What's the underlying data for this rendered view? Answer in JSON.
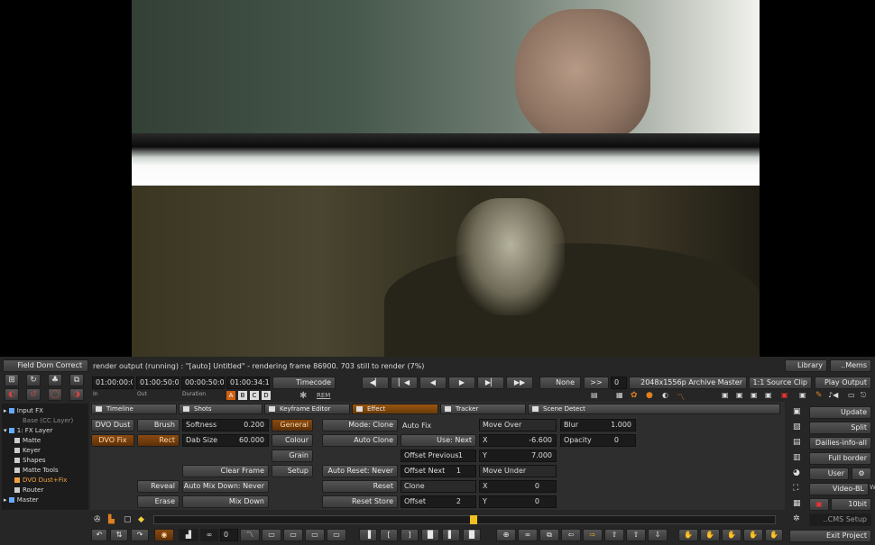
{
  "left_panel": {
    "field_dom_correct": "Field Dom Correct",
    "tree": [
      {
        "label": "Input FX",
        "level": 0,
        "accent": false
      },
      {
        "label": "Base (CC Layer)",
        "level": 1,
        "accent": false
      },
      {
        "label": "1: FX Layer",
        "level": 0,
        "accent": false
      },
      {
        "label": "Matte",
        "level": 2,
        "accent": false
      },
      {
        "label": "Keyer",
        "level": 2,
        "accent": false
      },
      {
        "label": "Shapes",
        "level": 2,
        "accent": false
      },
      {
        "label": "Matte Tools",
        "level": 2,
        "accent": false
      },
      {
        "label": "DVO Dust+Fix",
        "level": 2,
        "accent": true
      },
      {
        "label": "Router",
        "level": 2,
        "accent": false
      },
      {
        "label": "Master",
        "level": 0,
        "accent": false
      }
    ]
  },
  "status": {
    "render_text": "render output (running) : \"[auto] Untitled\" - rendering frame 86900. 703 still to render (7%)"
  },
  "timecodes": {
    "in": "01:00:00:00",
    "in_label": "In",
    "out": "01:00:50:00",
    "out_label": "Out",
    "duration": "00:00:50:00",
    "duration_label": "Duration",
    "current": "01:00:34:12",
    "mode_button": "Timecode",
    "abcd": [
      "A",
      "B",
      "C",
      "D"
    ],
    "rem_label": "REM"
  },
  "transport": {
    "none_label": "None",
    "chevron_label": ">>",
    "frame_value": "0",
    "resolution": "2048x1556p Archive Master",
    "source_clip": "1:1 Source Clip",
    "play_output": "Play Output"
  },
  "right_panel": {
    "library": "Library",
    "mems": "..Mems",
    "update": "Update",
    "split": "Split",
    "dailies": "Dailies-info-all",
    "full_border": "Full border",
    "user": "User",
    "video_bl": "Video-BL",
    "bit_depth": "10bit",
    "cms_setup": "..CMS Setup",
    "exit_project": "Exit Project",
    "side_label": "W"
  },
  "tabs": [
    "Timeline",
    "Shots",
    "Keyframe Editor",
    "Effect",
    "Tracker",
    "Scene Detect"
  ],
  "effect": {
    "dvo_dust": "DVO Dust",
    "dvo_fix": "DVO Fix",
    "brush": "Brush",
    "rect": "Rect",
    "softness_label": "Softness",
    "softness_value": "0.200",
    "dab_size_label": "Dab Size",
    "dab_size_value": "60.000",
    "general": "General",
    "colour": "Colour",
    "grain": "Grain",
    "setup": "Setup",
    "clear_frame": "Clear Frame",
    "reveal": "Reveal",
    "erase": "Erase",
    "auto_mix_down": "Auto Mix Down: Never",
    "mix_down": "Mix Down",
    "mode_clone": "Mode: Clone",
    "auto_clone": "Auto Clone",
    "auto_reset": "Auto Reset: Never",
    "reset": "Reset",
    "reset_store": "Reset Store",
    "auto_fix": "Auto Fix",
    "use_next": "Use: Next",
    "offset_previous_label": "Offset Previous",
    "offset_previous_value": "-1",
    "offset_next_label": "Offset Next",
    "offset_next_value": "1",
    "clone": "Clone",
    "offset_label": "Offset",
    "offset_value": "2",
    "move_over": "Move Over",
    "x1_label": "X",
    "x1_value": "-6.600",
    "y1_label": "Y",
    "y1_value": "7.000",
    "move_under": "Move Under",
    "x2_label": "X",
    "x2_value": "0",
    "y2_label": "Y",
    "y2_value": "0",
    "blur_label": "Blur",
    "blur_value": "1.000",
    "opacity_label": "Opacity",
    "opacity_value": "0"
  },
  "bottom": {
    "frame_field": "0"
  },
  "colors": {
    "accent_orange": "#8a4a10",
    "panel_bg": "#2b2b2b",
    "button_bg": "#484848"
  }
}
